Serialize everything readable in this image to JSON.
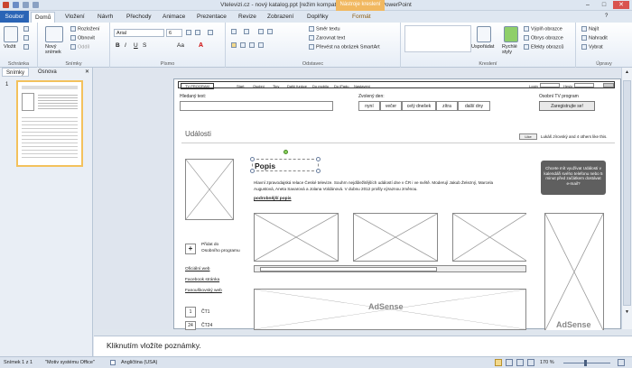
{
  "window": {
    "title": "Vtelevizi.cz - nový katalog.ppt [režim kompatibility] - Microsoft PowerPoint",
    "context_tab": "Nástroje kreslení"
  },
  "tabs": {
    "file": "Soubor",
    "items": [
      "Domů",
      "Vložení",
      "Návrh",
      "Přechody",
      "Animace",
      "Prezentace",
      "Revize",
      "Zobrazení",
      "Doplňky",
      "Formát"
    ]
  },
  "ribbon": {
    "clipboard": {
      "paste": "Vložit",
      "label": "Schránka"
    },
    "slides": {
      "new_slide": "Nový snímek",
      "layout": "Rozložení",
      "reset": "Obnovit",
      "section": "Oddíl",
      "label": "Snímky"
    },
    "font": {
      "name": "Arial",
      "size": "6",
      "bold": "B",
      "italic": "I",
      "underline": "U",
      "strike": "S",
      "aa": "Aa",
      "label": "Písmo"
    },
    "paragraph": {
      "direction": "Směr textu",
      "align": "Zarovnat text",
      "smartart": "Převést na obrázek SmartArt",
      "label": "Odstavec"
    },
    "drawing": {
      "arrange": "Uspořádat",
      "quick_styles": "Rychlé styly",
      "fill": "Výplň obrazce",
      "outline": "Obrys obrazce",
      "effects": "Efekty obrazců",
      "label": "Kreslení"
    },
    "editing": {
      "find": "Najít",
      "replace": "Nahradit",
      "select": "Vybrat",
      "label": "Úpravy"
    }
  },
  "leftpane": {
    "tab_slides": "Snímky",
    "tab_outline": "Osnova",
    "slide_number": "1"
  },
  "slide": {
    "nav": [
      "TV PROGRAM",
      "Start",
      "Osobní",
      "Tipy",
      "Další funkce",
      "Do mobilu",
      "Do iPadu",
      "Nastavení",
      "Nastavení"
    ],
    "login_label": "Login",
    "password_label": "Heslo",
    "search_label": "Hledaný text:",
    "day_label": "Zvolený den:",
    "day_buttons": [
      "nyní",
      "večer",
      "celý dnešek",
      "zítra",
      "další dny"
    ],
    "personal_label": "Osobní TV program",
    "register_button": "Zaregistrujte se!",
    "section_title": "Události",
    "like_label": "Like",
    "like_text": "Lukáš Jírovský and 4 others like this.",
    "heading": "Popis",
    "description_line1": "Hlavní zpravodajská relace České televize. Souhrn nejdůležitějších událostí dne v ČR i ve světě. Moderují Jakub Železný, Marcela",
    "description_line2": "Augustová, Aneta Savarová a Jolana Voldánová. V dubnu 2012 prošly výraznou změnou.",
    "more_link": "podrobnější popis",
    "add_label_1": "Přidat do",
    "add_label_2": "Osobního programu",
    "links": [
      "Oficiální web",
      "Facebook stránka",
      "Fanouškovský web"
    ],
    "day_rows": [
      {
        "num": "1",
        "day": "ČT1"
      },
      {
        "num": "24",
        "day": "ČT24"
      }
    ],
    "promo_text": "Chcete mít využívat Události v kalendáři svého telefonu nebo 5 minut před začátkem dostávat e-mail?",
    "adsense_1": "AdSense",
    "adsense_2": "AdSense"
  },
  "notes": {
    "placeholder": "Kliknutím vložíte poznámky."
  },
  "status": {
    "slide": "Snímek 1 z 1",
    "theme": "\"Motiv systému Office\"",
    "language": "Angličtina (USA)",
    "zoom": "170 %"
  }
}
